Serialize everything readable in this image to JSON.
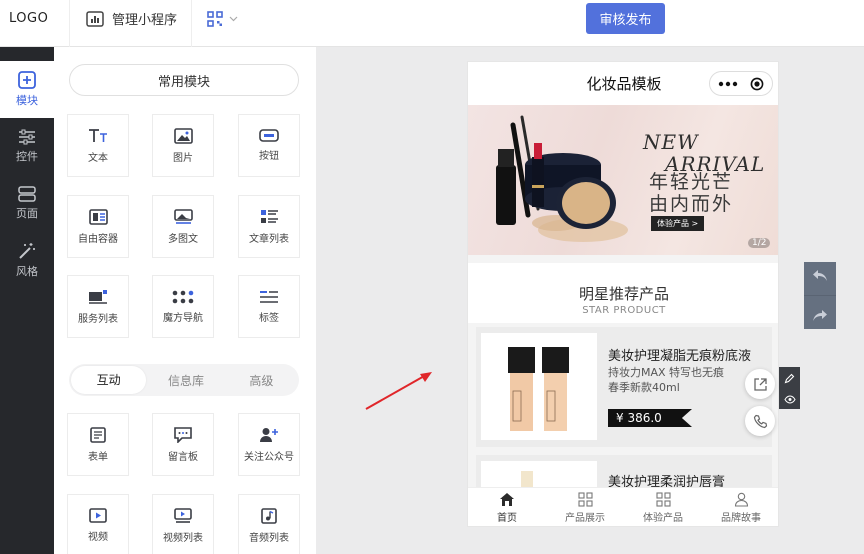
{
  "header": {
    "logo": "LOGO",
    "manage_label": "管理小程序",
    "publish_label": "审核发布"
  },
  "rail": {
    "items": [
      {
        "label": "模块",
        "icon": "plus-square-icon"
      },
      {
        "label": "控件",
        "icon": "sliders-icon"
      },
      {
        "label": "页面",
        "icon": "page-icon"
      },
      {
        "label": "风格",
        "icon": "magic-wand-icon"
      }
    ]
  },
  "panel": {
    "common_title": "常用模块",
    "common_modules": [
      {
        "label": "文本",
        "icon": "text-icon"
      },
      {
        "label": "图片",
        "icon": "image-icon"
      },
      {
        "label": "按钮",
        "icon": "button-icon"
      },
      {
        "label": "自由容器",
        "icon": "container-icon"
      },
      {
        "label": "多图文",
        "icon": "multi-image-icon"
      },
      {
        "label": "文章列表",
        "icon": "article-list-icon"
      },
      {
        "label": "服务列表",
        "icon": "service-list-icon"
      },
      {
        "label": "魔方导航",
        "icon": "grid-nav-icon"
      },
      {
        "label": "标签",
        "icon": "tag-icon"
      }
    ],
    "tabs": [
      "互动",
      "信息库",
      "高级"
    ],
    "active_tab": "互动",
    "interactive_modules": [
      {
        "label": "表单",
        "icon": "form-icon"
      },
      {
        "label": "留言板",
        "icon": "message-board-icon"
      },
      {
        "label": "关注公众号",
        "icon": "follow-user-icon"
      },
      {
        "label": "视频",
        "icon": "video-icon"
      },
      {
        "label": "视频列表",
        "icon": "video-list-icon"
      },
      {
        "label": "音频列表",
        "icon": "audio-list-icon"
      }
    ]
  },
  "phone": {
    "title": "化妆品模板",
    "banner": {
      "line1": "NEW",
      "line2": "ARRIVAL",
      "cn1": "年轻光芒",
      "cn2": "由内而外",
      "button": "体验产品 >",
      "page": "1/2"
    },
    "section_title": "明星推荐产品",
    "section_subtitle": "STAR PRODUCT",
    "products": [
      {
        "name": "美妆护理凝脂无痕粉底液",
        "desc1": "持妆力MAX 特写也无痕",
        "desc2": "春季新款40ml",
        "price": "¥ 386.0"
      },
      {
        "name": "美妆护理柔润护唇膏"
      }
    ],
    "tabbar": [
      {
        "label": "首页",
        "icon": "home-icon"
      },
      {
        "label": "产品展示",
        "icon": "grid-icon"
      },
      {
        "label": "体验产品",
        "icon": "grid-icon"
      },
      {
        "label": "品牌故事",
        "icon": "user-icon"
      }
    ]
  },
  "colors": {
    "accent": "#5271dc",
    "rail_bg": "#26282c",
    "arrow": "#e0262a"
  }
}
